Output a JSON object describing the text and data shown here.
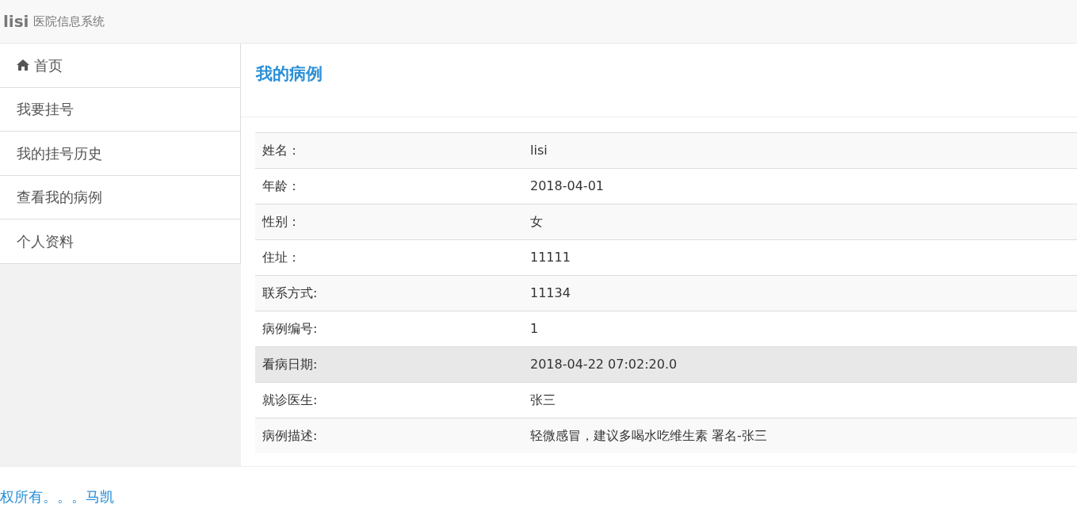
{
  "navbar": {
    "brand": "lisi",
    "subtitle": "医院信息系统"
  },
  "sidebar": {
    "items": [
      {
        "kind": "with_icon",
        "label": "首页",
        "selected": false
      },
      {
        "kind": "plain",
        "label": "我要挂号",
        "selected": false
      },
      {
        "kind": "plain",
        "label": "我的挂号历史",
        "selected": false
      },
      {
        "kind": "plain",
        "label": "查看我的病例",
        "selected": false
      },
      {
        "kind": "plain",
        "label": "个人资料",
        "selected": false
      }
    ]
  },
  "page": {
    "title": "我的病例"
  },
  "table": {
    "rows": [
      {
        "label": "姓名：",
        "value": "lisi",
        "highlighted": false
      },
      {
        "label": "年龄：",
        "value": "2018-04-01",
        "highlighted": false
      },
      {
        "label": "性别：",
        "value": "女",
        "highlighted": false
      },
      {
        "label": "住址：",
        "value": "11111",
        "highlighted": false
      },
      {
        "label": "联系方式:",
        "value": "11134",
        "highlighted": false
      },
      {
        "label": "病例编号:",
        "value": "1",
        "highlighted": false
      },
      {
        "label": "看病日期:",
        "value": "2018-04-22 07:02:20.0",
        "highlighted": true
      },
      {
        "label": "就诊医生:",
        "value": "张三",
        "highlighted": false
      },
      {
        "label": "病例描述:",
        "value": "轻微感冒，建议多喝水吃维生素 署名-张三",
        "highlighted": false
      }
    ]
  },
  "footer": {
    "text": "权所有。。。马凯"
  }
}
